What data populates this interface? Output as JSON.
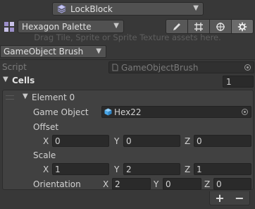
{
  "header": {
    "lock_title": "LockBlock"
  },
  "palette": {
    "selected": "Hexagon Palette",
    "drag_hint": "Drag Tile, Sprite or Sprite Texture assets here."
  },
  "toolbar": {
    "tools": [
      "pencil-icon",
      "grid-icon",
      "target-icon",
      "settings-icon"
    ]
  },
  "brush": {
    "selected": "GameObject Brush"
  },
  "inspector": {
    "script_label": "Script",
    "script_value": "GameObjectBrush",
    "cells_label": "Cells",
    "cells_count": "1",
    "element": {
      "label": "Element 0",
      "game_object_label": "Game Object",
      "game_object_value": "Hex22",
      "offset_label": "Offset",
      "offset": {
        "x": "0",
        "y": "0",
        "z": "0"
      },
      "scale_label": "Scale",
      "scale": {
        "x": "1",
        "y": "2",
        "z": "1"
      },
      "orientation_label": "Orientation",
      "orientation": {
        "x": "2",
        "y": "0",
        "z": "0"
      }
    },
    "axis_labels": {
      "x": "X",
      "y": "Y",
      "z": "Z"
    },
    "add_label": "+",
    "remove_label": "−"
  },
  "colors": {
    "background": "#383838",
    "field_bg": "#2a2a2a",
    "dropdown_bg": "#515151",
    "text": "#d2d2d2",
    "disabled_text": "#7a7a7a",
    "object_icon": "#4aa8e8"
  }
}
